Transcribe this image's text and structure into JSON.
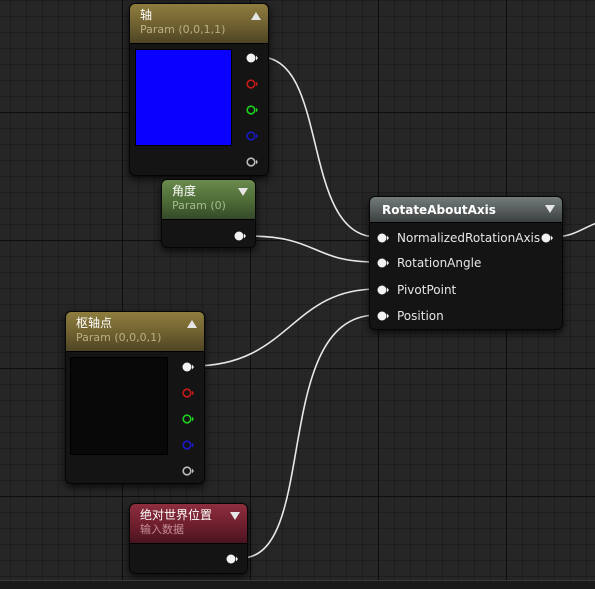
{
  "nodes": {
    "axis": {
      "title": "轴",
      "subtitle": "Param (0,0,1,1)",
      "preview_color": "#0a00ff"
    },
    "angle": {
      "title": "角度",
      "subtitle": "Param (0)"
    },
    "pivot": {
      "title": "枢轴点",
      "subtitle": "Param (0,0,0,1)",
      "preview_color": "#080808"
    },
    "world_pos": {
      "title": "绝对世界位置",
      "subtitle": "输入数据"
    },
    "rotate": {
      "title": "RotateAboutAxis",
      "inputs": [
        "NormalizedRotationAxis",
        "RotationAngle",
        "PivotPoint",
        "Position"
      ]
    }
  },
  "colors": {
    "pin_white": "#f2f2f2",
    "pin_red": "#c81a1a",
    "pin_green": "#1ed21e",
    "pin_blue": "#1a1ac8",
    "pin_gray": "#bdbdbd",
    "wire": "#e8e8e8"
  },
  "icons": {
    "pin": "exec-pin-circle-arrow",
    "collapse": "triangle-toggle"
  }
}
